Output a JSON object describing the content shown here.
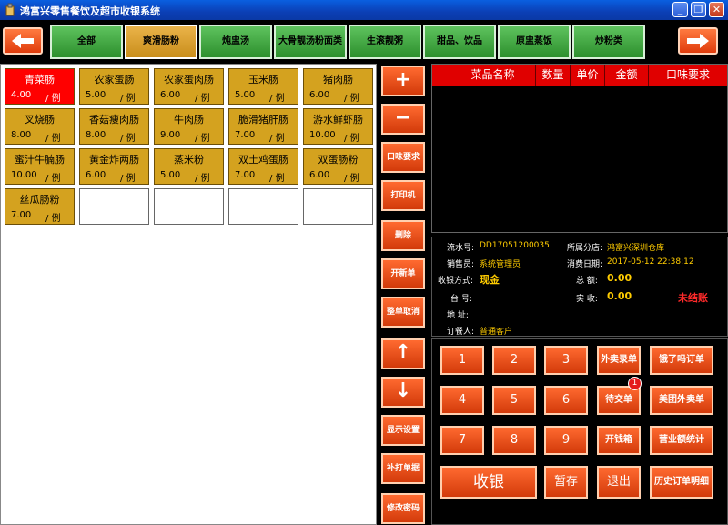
{
  "window": {
    "title": "鸿富兴零售餐饮及超市收银系统",
    "minimize": "_",
    "restore": "❐",
    "close": "✕"
  },
  "categories": [
    "全部",
    "爽滑肠粉",
    "炖盅汤",
    "大骨靓汤粉面类",
    "生滚靓粥",
    "甜品、饮品",
    "原盅蒸饭",
    "炒粉类"
  ],
  "active_category": "爽滑肠粉",
  "dishes": [
    {
      "name": "青菜肠",
      "price": "4.00",
      "unit": "/ 例",
      "selected": true
    },
    {
      "name": "农家蛋肠",
      "price": "5.00",
      "unit": "/ 例"
    },
    {
      "name": "农家蛋肉肠",
      "price": "6.00",
      "unit": "/ 例"
    },
    {
      "name": "玉米肠",
      "price": "5.00",
      "unit": "/ 例"
    },
    {
      "name": "猪肉肠",
      "price": "6.00",
      "unit": "/ 例"
    },
    {
      "name": "叉烧肠",
      "price": "8.00",
      "unit": "/ 例"
    },
    {
      "name": "香菇瘦肉肠",
      "price": "8.00",
      "unit": "/ 例"
    },
    {
      "name": "牛肉肠",
      "price": "9.00",
      "unit": "/ 例"
    },
    {
      "name": "脆滑猪肝肠",
      "price": "7.00",
      "unit": "/ 例"
    },
    {
      "name": "游水鲜虾肠",
      "price": "10.00",
      "unit": "/ 例"
    },
    {
      "name": "蜜汁牛腩肠",
      "price": "10.00",
      "unit": "/ 例"
    },
    {
      "name": "黄金炸两肠",
      "price": "6.00",
      "unit": "/ 例"
    },
    {
      "name": "蒸米粉",
      "price": "5.00",
      "unit": "/ 例"
    },
    {
      "name": "双土鸡蛋肠",
      "price": "7.00",
      "unit": "/ 例"
    },
    {
      "name": "双蛋肠粉",
      "price": "6.00",
      "unit": "/ 例"
    },
    {
      "name": "丝瓜肠粉",
      "price": "7.00",
      "unit": "/ 例"
    }
  ],
  "actions": {
    "plus": "+",
    "minus": "−",
    "taste": "口味要求",
    "print": "打印机",
    "delete": "删除",
    "new_order": "开新单",
    "cancel_order": "整单取消",
    "up": "↑",
    "down": "↓",
    "display_settings": "显示设置",
    "reprint": "补打单据",
    "change_password": "修改密码"
  },
  "order_table": {
    "columns": [
      "菜品名称",
      "数量",
      "单价",
      "金额",
      "口味要求"
    ]
  },
  "info": {
    "serial_label": "流水号:",
    "serial": "DD17051200035",
    "branch_label": "所属分店:",
    "branch": "鸿富兴深圳仓库",
    "seller_label": "销售员:",
    "seller": "系统管理员",
    "date_label": "消费日期:",
    "date": "2017-05-12 22:38:12",
    "pay_label": "收银方式:",
    "pay": "现金",
    "total_label": "总    额:",
    "total": "0.00",
    "table_label": "台    号:",
    "received_label": "实    收:",
    "received": "0.00",
    "address_label": "地    址:",
    "unsettled": "未结账",
    "customer_label": "订餐人:",
    "customer": "普通客户"
  },
  "keypad": {
    "digits": [
      "1",
      "2",
      "3",
      "4",
      "5",
      "6",
      "7",
      "8",
      "9"
    ],
    "takeout_entry": "外卖录单",
    "eleme_orders": "饿了吗订单",
    "pending": "待交单",
    "pending_count": "1",
    "meituan_orders": "美团外卖单",
    "cash_drawer": "开钱箱",
    "sales_stats": "营业额统计",
    "checkout": "收银",
    "hold": "暂存",
    "exit": "退出",
    "history": "历史订单明细"
  },
  "colors": {
    "titlebar": "#0b3fb5",
    "category_green": "#3da83d",
    "category_active": "#d9a232",
    "dish_gold": "#d4a21f",
    "dish_selected": "#ff0000",
    "action_orange": "#e8501a",
    "table_header_red": "#e00000",
    "value_yellow": "#ffcc00"
  }
}
